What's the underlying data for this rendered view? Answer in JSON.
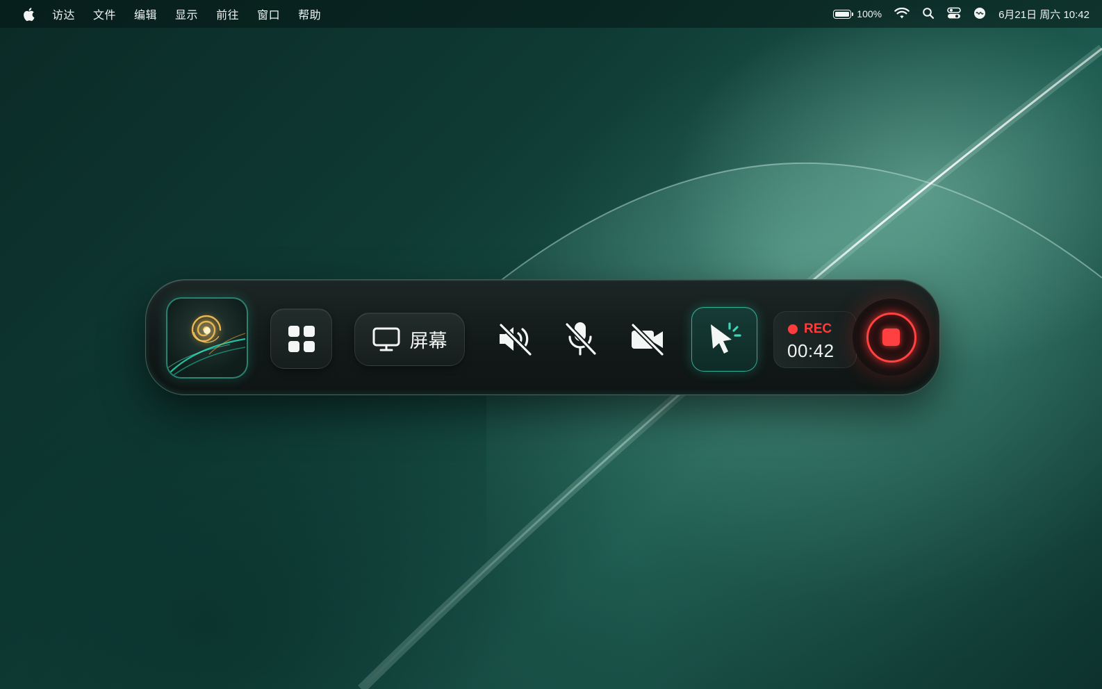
{
  "menubar": {
    "apple_icon": "apple-logo-icon",
    "menus": [
      "访达",
      "文件",
      "编辑",
      "显示",
      "前往",
      "窗口",
      "帮助"
    ],
    "battery_percent": "100%",
    "status_icons": [
      "battery-icon",
      "wifi-icon",
      "search-icon",
      "control-center-icon",
      "siri-icon"
    ],
    "clock": "6月21日 周六 10:42"
  },
  "toolbar": {
    "app_icon": "app-spiral-icon",
    "apps_icon": "grid-icon",
    "source_label": "屏幕",
    "source_icon": "monitor-icon",
    "speaker_state": "muted",
    "mic_state": "muted",
    "camera_state": "off",
    "cursor_highlight_state": "on",
    "rec_label": "REC",
    "rec_time": "00:42",
    "stop_icon": "stop-icon"
  },
  "colors": {
    "accent_teal": "#3cd7b9",
    "record_red": "#ff3b3b",
    "toolbar_bg": "#141c1b"
  }
}
